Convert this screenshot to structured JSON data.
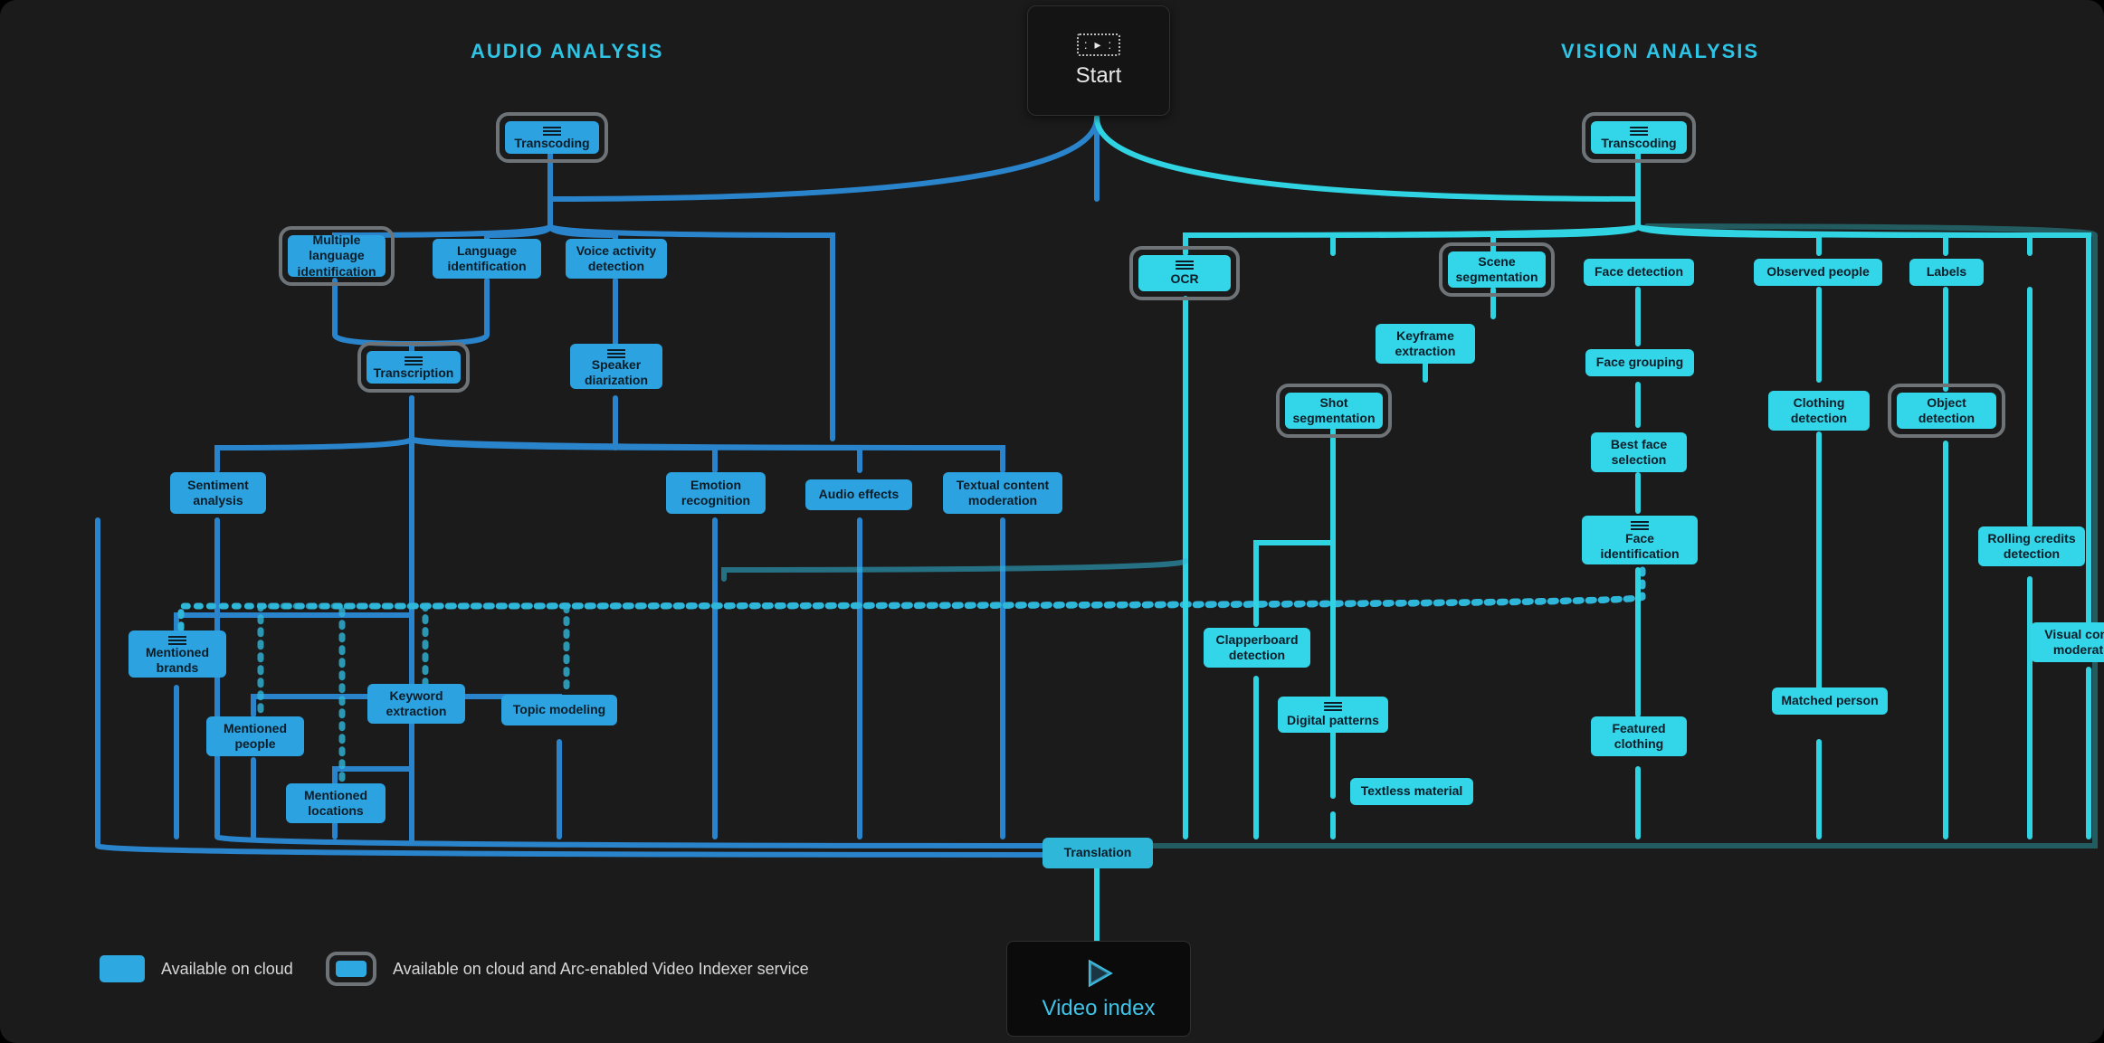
{
  "headers": {
    "audio": "AUDIO ANALYSIS",
    "vision": "VISION ANALYSIS"
  },
  "start": {
    "label": "Start"
  },
  "end": {
    "label": "Video index"
  },
  "legend": {
    "cloud": "Available on cloud",
    "arc": "Available on cloud and Arc-enabled Video Indexer service"
  },
  "nodes": {
    "a_transcoding": "Transcoding",
    "a_mli": "Multiple language identification",
    "a_li": "Language identification",
    "a_vad": "Voice activity detection",
    "a_transcription": "Transcription",
    "a_spk": "Speaker diarization",
    "a_sent": "Sentiment analysis",
    "a_emo": "Emotion recognition",
    "a_afx": "Audio effects",
    "a_txtmod": "Textual content moderation",
    "a_brands": "Mentioned brands",
    "a_people": "Mentioned people",
    "a_loc": "Mentioned locations",
    "a_kw": "Keyword extraction",
    "a_topic": "Topic modeling",
    "translation": "Translation",
    "v_transcoding": "Transcoding",
    "v_ocr": "OCR",
    "v_scene": "Scene segmentation",
    "v_facedet": "Face detection",
    "v_obs": "Observed people",
    "v_labels": "Labels",
    "v_keyframe": "Keyframe extraction",
    "v_facegrp": "Face grouping",
    "v_shot": "Shot segmentation",
    "v_clothdet": "Clothing detection",
    "v_objdet": "Object detection",
    "v_bestface": "Best face selection",
    "v_faceid": "Face identification",
    "v_rolling": "Rolling credits detection",
    "v_clap": "Clapperboard detection",
    "v_vcm": "Visual content moderation",
    "v_digital": "Digital patterns",
    "v_matched": "Matched person",
    "v_featured": "Featured clothing",
    "v_textless": "Textless material"
  },
  "diagram_structure": {
    "audio_branch_from_transcoding": [
      "a_mli",
      "a_li",
      "a_vad"
    ],
    "a_mli_to": [
      "a_transcription"
    ],
    "a_li_to": [
      "a_transcription"
    ],
    "a_vad_to": [
      "a_spk"
    ],
    "a_transcription_to": [
      "a_sent",
      "a_emo",
      "a_afx",
      "a_txtmod",
      "a_brands",
      "a_people",
      "a_loc",
      "a_kw",
      "a_topic"
    ],
    "a_spk_feeds": [
      "a_emo"
    ],
    "translation_inputs": [
      "a_transcription",
      "v_ocr"
    ],
    "vision_branch_from_transcoding": [
      "v_ocr",
      "v_scene",
      "v_facedet",
      "v_obs",
      "v_labels",
      "v_objdet",
      "v_rolling",
      "v_vcm"
    ],
    "v_scene_to": [
      "v_keyframe"
    ],
    "v_keyframe_to": [
      "v_shot"
    ],
    "v_shot_to": [
      "v_clap",
      "v_digital",
      "v_textless"
    ],
    "v_facedet_to": [
      "v_facegrp"
    ],
    "v_facegrp_to": [
      "v_bestface"
    ],
    "v_bestface_to": [
      "v_faceid"
    ],
    "v_faceid_to": [
      "v_matched",
      "v_featured",
      "a_emo",
      "a_topic",
      "a_brands",
      "a_people",
      "a_loc"
    ],
    "v_obs_to": [
      "v_clothdet",
      "v_matched"
    ],
    "v_clothdet_to": [
      "v_featured"
    ],
    "video_index_inputs": [
      "translation",
      "a_sent",
      "a_emo",
      "a_afx",
      "a_txtmod",
      "a_brands",
      "a_people",
      "a_loc",
      "a_kw",
      "a_topic",
      "v_ocr",
      "v_clap",
      "v_digital",
      "v_textless",
      "v_featured",
      "v_matched",
      "v_rolling",
      "v_vcm",
      "v_labels",
      "v_objdet"
    ]
  }
}
